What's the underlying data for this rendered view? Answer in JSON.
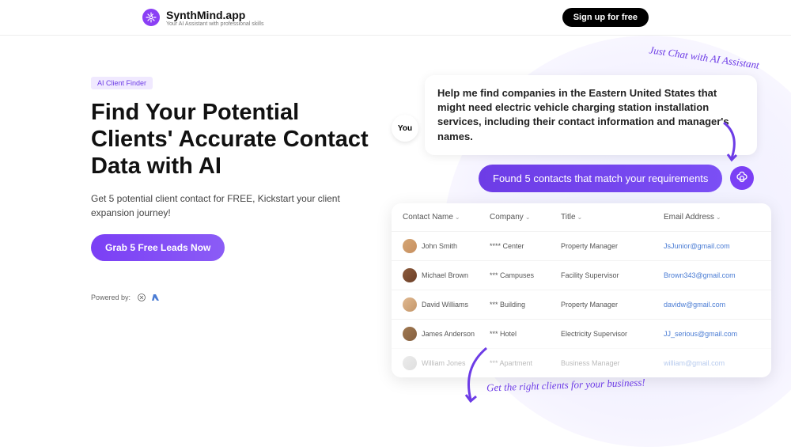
{
  "header": {
    "brand_name": "SynthMind.app",
    "brand_tagline": "Your AI Assistant with professional skills",
    "signup_label": "Sign up for free"
  },
  "hero": {
    "badge": "AI Client Finder",
    "title": "Find Your Potential Clients' Accurate Contact Data with AI",
    "subtitle": "Get 5 potential client contact for FREE, Kickstart your client expansion journey!",
    "cta_label": "Grab 5 Free Leads Now",
    "powered_label": "Powered by:"
  },
  "annotations": {
    "top": "Just Chat with AI Assistant",
    "bottom": "Get the right clients for your business!"
  },
  "chat": {
    "you_label": "You",
    "user_message": "Help me find companies in the Eastern United States that might need electric vehicle charging station installation services, including their contact information and manager's names.",
    "ai_response": "Found 5 contacts that match your requirements"
  },
  "table": {
    "headers": {
      "contact": "Contact Name",
      "company": "Company",
      "title": "Title",
      "email": "Email Address"
    },
    "rows": [
      {
        "name": "John Smith",
        "company": "**** Center",
        "title": "Property Manager",
        "email": "JsJunior@gmail.com",
        "avatar": "a1"
      },
      {
        "name": "Michael Brown",
        "company": "*** Campuses",
        "title": "Facility Supervisor",
        "email": "Brown343@gmail.com",
        "avatar": "a2"
      },
      {
        "name": "David Williams",
        "company": "*** Building",
        "title": "Property Manager",
        "email": "davidw@gmail.com",
        "avatar": "a3"
      },
      {
        "name": "James Anderson",
        "company": "*** Hotel",
        "title": "Electricity Supervisor",
        "email": "JJ_serious@gmail.com",
        "avatar": "a4"
      },
      {
        "name": "William Jones",
        "company": "*** Apartment",
        "title": "Business Manager",
        "email": "william@gmail.com",
        "avatar": "a5",
        "faded": true
      }
    ]
  }
}
